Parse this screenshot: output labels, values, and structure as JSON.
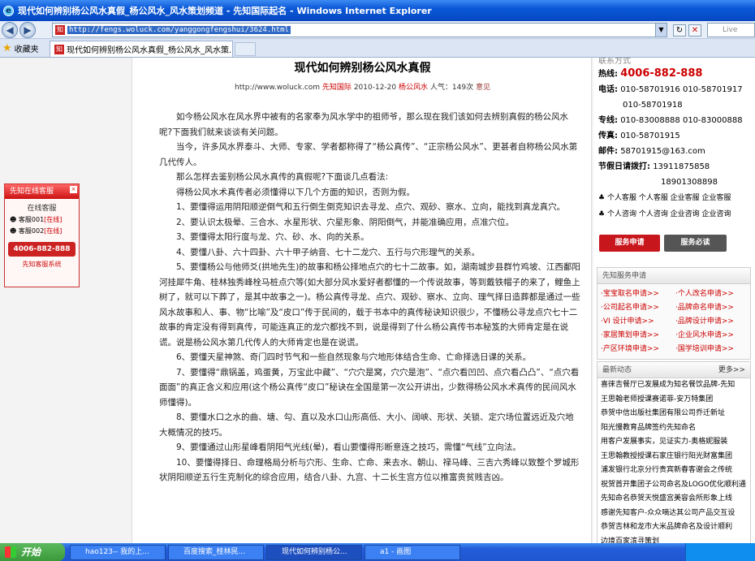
{
  "window": {
    "title": "现代如何辨别杨公风水真假_杨公风水_风水策划频道 - 先知国际起名 - Windows Internet Explorer"
  },
  "toolbar": {
    "url": "http://fengs.woluck.com/yanggongfengshui/3624.html",
    "search_placeholder": "Live Search",
    "favorites_label": "收藏夹",
    "tab_title": "现代如何辨别杨公风水真假_杨公风水_风水策..."
  },
  "article": {
    "title": "现代如何辨别杨公风水真假",
    "meta": {
      "site": "http://www.woluck.com",
      "source": "先知国际",
      "date": "2010-12-20",
      "category": "杨公风水",
      "views_label": "人气：149次",
      "comment": "意见"
    },
    "paragraphs": [
      "如今杨公风水在风水界中被有的名家奉为风水学中的祖师爷，那么现在我们该如何去辨别真假的杨公风水呢?下面我们就来谈谈有关问题。",
      "当今，许多风水界泰斗、大师、专家、学者都称得了“杨公真传”、“正宗杨公风水”、更甚者自称杨公风水第几代传人。",
      "那么怎样去鉴别杨公风水真传的真假呢?下面谈几点看法:",
      "得杨公风水术真传者必须懂得以下几个方面的知识，否则为假。",
      "1、要懂得运用阴阳顺逆倒气和五行倒生倒克知识去寻龙、点穴、观砂、察水、立向，能找到真龙真穴。",
      "2、要认识太极晕、三合水、水星形状、穴星形象、阴阳倒气，并能准确应用，点准穴位。",
      "3、要懂得太阳行度与龙、穴、砂、水、向的关系。",
      "4、要懂八卦、六十四卦、六十甲子纳音、七十二龙穴、五行与穴形理气的关系。",
      "5、要懂杨公与他师爻(拱地先生)的故事和杨公择地点穴的七十二故事。如，湖南城步县群竹鸡坡、江西鄱阳河挂犀牛角、桂林独秀峰栓马桩点穴等(如大部分风水爱好者都懂的一个传说故事，等到戴铁帽子的来了，鲤鱼上树了，就可以下葬了，是其中故事之一)。杨公真传寻龙、点穴、观砂、察水、立向、理气择日造葬都是通过一些风水故事和人、事、物“比喻”及“皮口”传于民间的，载于书本中的真传秘诀知识很少，不懂杨公寻龙点穴七十二故事的肯定没有得到真传，可能连真正的龙穴都找不到，说是得到了什么杨公真传书本秘笈的大师肯定是在说谎。说是杨公风水第几代传人的大师肯定也是在说谎。",
      "6、要懂天星神煞、奇门四时节气和一些自然现象与穴地形体结合生命、亡命择选日课的关系。",
      "7、要懂得“鼎锅盖，鸡蛋黄，万宝此中藏”、“穴穴是窝，穴穴是泡”、“点穴看凹凹、点穴看凸凸”、“点穴看面面”的真正含义和应用(这个杨公真传“皮口”秘诀在全国是第一次公开讲出，少数得杨公风水术真传的民间风水师懂得)。",
      "8、要懂水口之水的曲、塘、勾、直以及水口山形高低、大小、阔峡、形状、关锁、定穴场位置远近及穴地大概情况的技巧。",
      "9、要懂通过山形星峰看阴阳气光线(晕)，看山要懂得形断意连之技巧，需懂“气线”立向法。",
      "10、要懂得择日、命理格局分析与穴形、生命、亡命、来去水、朝山、禄马峰、三吉六秀峰以致整个罗城形状阴阳顺逆五行生克制化的综合应用，结合八卦、九宫、十二长生宫方位以推富贵贫贱吉凶。"
    ]
  },
  "chat": {
    "header": "先知在线客服",
    "close": "×",
    "subtitle": "在线客服",
    "agents": [
      {
        "name": "客服001",
        "status": "[在线]"
      },
      {
        "name": "客服002",
        "status": "[在线]"
      }
    ],
    "phone": "4006-882-888",
    "footer": "先知客服系统"
  },
  "contact": {
    "heading": "联系方式",
    "hotline_label": "热线:",
    "hotline": "4006-882-888",
    "phone_label": "电话:",
    "phones": [
      "010-58701916 010-58701917",
      "010-58701918"
    ],
    "line_label": "专线:",
    "line": "010-83008888 010-83000888",
    "fax_label": "传真:",
    "fax": "010-58701915",
    "email_label": "邮件:",
    "email": "58701915@163.com",
    "holiday_label": "节假日请拨打:",
    "holiday": [
      "13911875858",
      "18901308898"
    ],
    "service_rows": [
      "个人客服  个人客服  企业客服  企业客服",
      "个人咨询  个人咨询  企业咨询  企业咨询"
    ],
    "apply_btn": "服务申请",
    "consult_btn": "服务必读"
  },
  "services": {
    "heading": "先知服务申请",
    "items": [
      "·宝宝取名申请>>",
      "·个人改名申请>>",
      "·公司起名申请>>",
      "·品牌命名申请>>",
      "·VI 设计申请>>",
      "·品牌设计申请>>",
      "·家居策划申请>>",
      "·企业风水申请>>",
      "·产区环境申请>>",
      "·国学培训申请>>"
    ]
  },
  "news": {
    "heading": "最新动态",
    "more": "更多>>",
    "items": [
      "喜徕吉餐厅已发展成为知名餐饮品牌-先知",
      "王思翰老师授课赛诺菲-安万特集团",
      "恭贺中信出版社集团有限公司乔迁新址",
      "阳光慢教育品牌签约先知命名",
      "用客户发展事实，见证实力-奥格妮服装",
      "王思翰教授授课石家庄银行阳光财富集团",
      "浦发银行北京分行贵宾新春客谢会之传统",
      "祝贺首开集团子公司命名及LOGO优化顺利通",
      "先知命名恭贺天悦盛宫美容会所形象上线",
      "感谢先知客户-众众嘀达其公司产品交互设",
      "恭贺吉林和龙市大米品牌命名及设计顺利",
      "边境百家滨寻策划"
    ]
  },
  "taskbar": {
    "start": "开始",
    "items": [
      "hao123-- 我的上...",
      "百度搜索_桂林民...",
      "现代如何辨别杨公...",
      "a1 - 画图"
    ]
  }
}
